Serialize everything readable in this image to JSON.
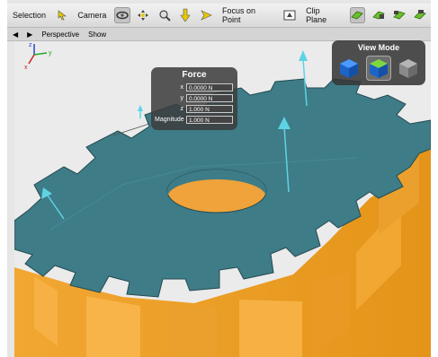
{
  "toolbar": {
    "selection_label": "Selection",
    "camera_label": "Camera",
    "focus_label": "Focus on Point",
    "clip_label": "Clip Plane"
  },
  "subbar": {
    "perspective_label": "Perspective",
    "show_label": "Show"
  },
  "axes": {
    "z": "z",
    "y": "y",
    "x": "x"
  },
  "force_panel": {
    "title": "Force",
    "rows": [
      {
        "label": "x",
        "value": "0.0000 N"
      },
      {
        "label": "y",
        "value": "0.0000 N"
      },
      {
        "label": "z",
        "value": "1.000 N"
      },
      {
        "label": "Magnitude",
        "value": "1.000 N"
      }
    ]
  },
  "view_mode": {
    "title": "View Mode",
    "options": [
      "solid-icon",
      "shaded-icon",
      "wireframe-icon"
    ],
    "selected": "shaded-icon"
  },
  "colors": {
    "gear_top": "#3f7f8a",
    "gear_side": "#f0a33a",
    "arrow": "#5fd3e6",
    "background": "#ebebeb"
  }
}
